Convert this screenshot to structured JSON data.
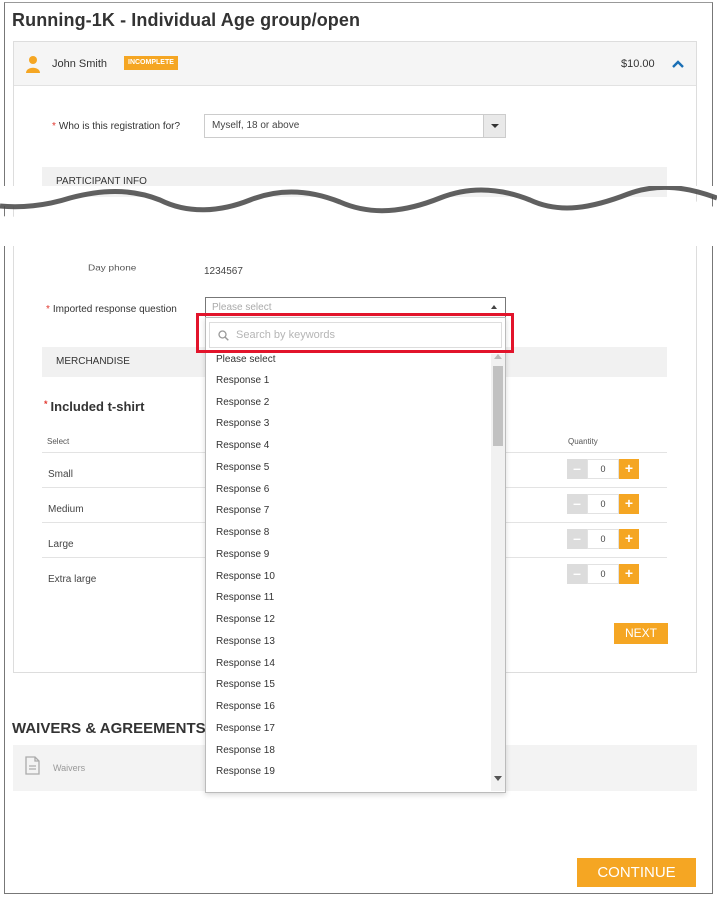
{
  "page": {
    "title": "Running-1K - Individual Age group/open"
  },
  "participant_card": {
    "name": "John Smith",
    "status_badge": "INCOMPLETE",
    "price": "$10.00"
  },
  "registration_for": {
    "label": "Who is this registration for?",
    "selected": "Myself, 18 or above"
  },
  "sections": {
    "participant_info": "PARTICIPANT INFO",
    "merchandise": "MERCHANDISE"
  },
  "day_phone": {
    "label": "Day phone",
    "value": "1234567"
  },
  "imported_question": {
    "label": "Imported response question",
    "selected": "Please select",
    "search_placeholder": "Search by keywords",
    "options": [
      "Please select",
      "Response 1",
      "Response 2",
      "Response 3",
      "Response 4",
      "Response 5",
      "Response 6",
      "Response 7",
      "Response 8",
      "Response 9",
      "Response 10",
      "Response 11",
      "Response 12",
      "Response 13",
      "Response 14",
      "Response 15",
      "Response 16",
      "Response 17",
      "Response 18",
      "Response 19"
    ]
  },
  "tshirt": {
    "title": "Included t-shirt",
    "col_select": "Select",
    "col_quantity": "Quantity",
    "sizes": [
      {
        "label": "Small",
        "quantity": "0"
      },
      {
        "label": "Medium",
        "quantity": "0"
      },
      {
        "label": "Large",
        "quantity": "0"
      },
      {
        "label": "Extra large",
        "quantity": "0"
      }
    ]
  },
  "buttons": {
    "next": "NEXT",
    "continue": "CONTINUE"
  },
  "waivers": {
    "title": "WAIVERS & AGREEMENTS",
    "item": "Waivers"
  },
  "colors": {
    "accent": "#f5a623",
    "highlight": "#e2142b",
    "link_blue": "#1a6fb5"
  }
}
